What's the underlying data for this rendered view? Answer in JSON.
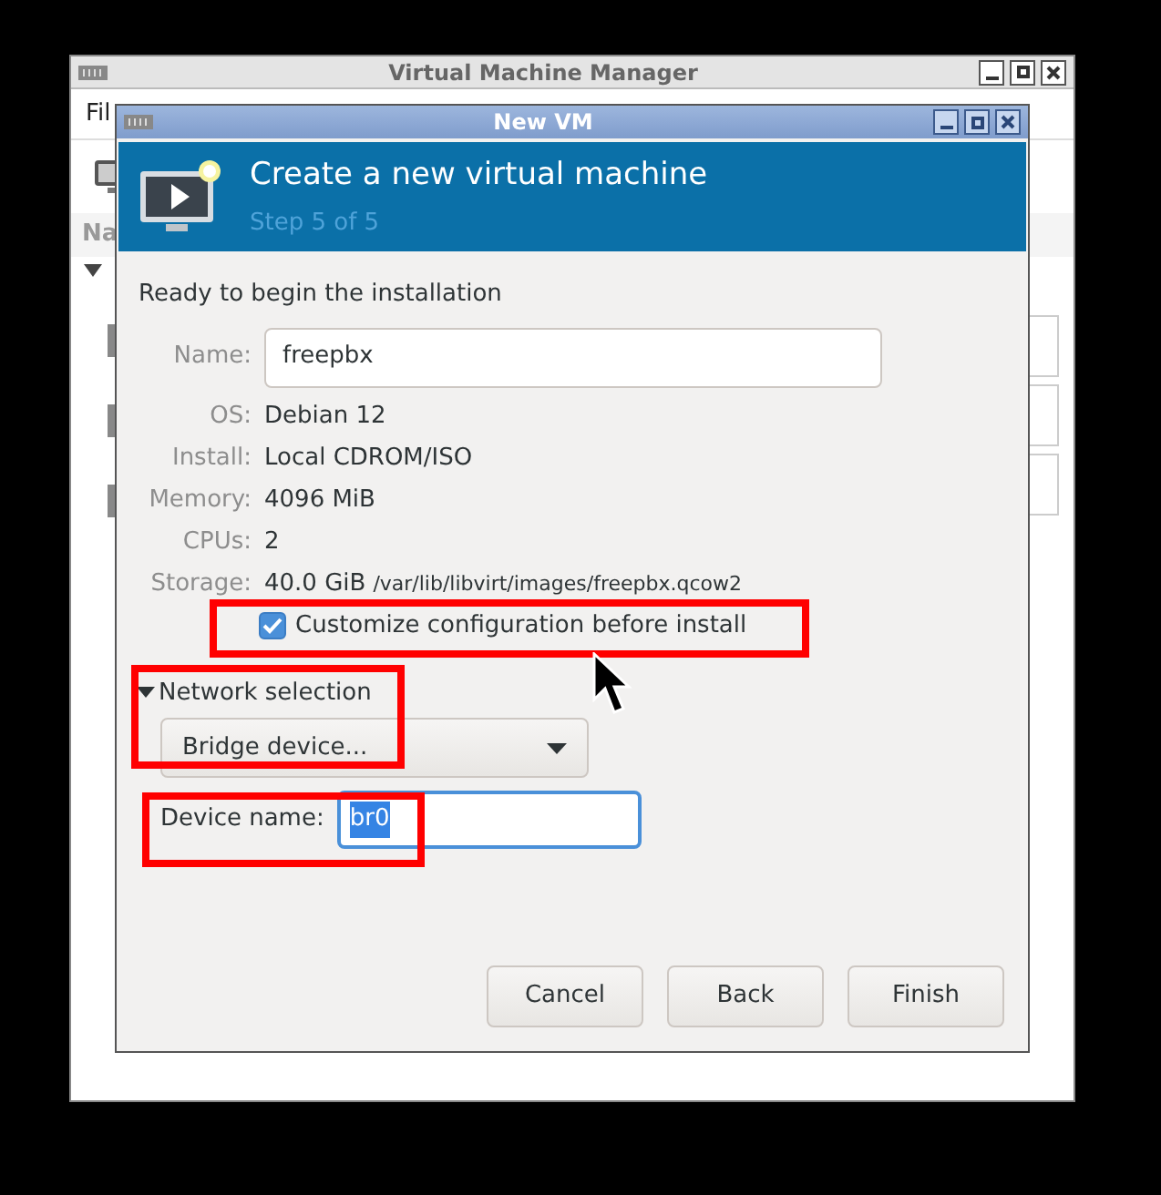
{
  "main_window": {
    "title": "Virtual Machine Manager",
    "menu_text": "Fil",
    "column_header": "Na"
  },
  "dialog": {
    "title": "New VM",
    "header": {
      "title": "Create a new virtual machine",
      "step": "Step 5 of 5"
    },
    "intro": "Ready to begin the installation",
    "name_field": {
      "label": "Name:",
      "value": "freepbx"
    },
    "details": [
      {
        "label": "OS:",
        "value": "Debian 12"
      },
      {
        "label": "Install:",
        "value": "Local CDROM/ISO"
      },
      {
        "label": "Memory:",
        "value": "4096 MiB"
      },
      {
        "label": "CPUs:",
        "value": "2"
      },
      {
        "label": "Storage:",
        "value": "40.0 GiB",
        "path": "/var/lib/libvirt/images/freepbx.qcow2"
      }
    ],
    "customize": {
      "label": "Customize configuration before install",
      "checked": true
    },
    "network": {
      "label": "Network selection",
      "expanded": true,
      "dropdown": "Bridge device...",
      "device_label": "Device name:",
      "device_value": "br0",
      "value_selected": true
    },
    "buttons": [
      "Cancel",
      "Back",
      "Finish"
    ]
  }
}
